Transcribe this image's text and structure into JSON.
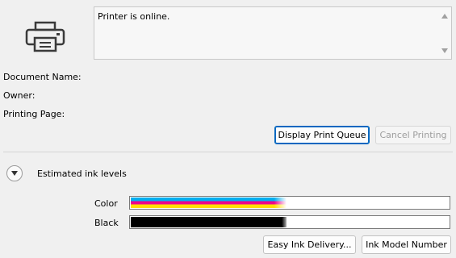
{
  "status": {
    "message": "Printer is online."
  },
  "details": {
    "document_name_label": "Document Name:",
    "owner_label": "Owner:",
    "printing_page_label": "Printing Page:"
  },
  "buttons": {
    "display_queue": "Display Print Queue",
    "cancel_printing": "Cancel Printing",
    "easy_ink_delivery": "Easy Ink Delivery...",
    "ink_model_number": "Ink Model Number"
  },
  "ink_section": {
    "title": "Estimated ink levels",
    "color": {
      "label": "Color",
      "level_fraction": 0.49,
      "colors": [
        "#00aeef",
        "#ec008c",
        "#ffde00"
      ]
    },
    "black": {
      "label": "Black",
      "level_fraction": 0.49,
      "color": "#000000"
    }
  },
  "icons": {
    "printer": "printer-icon",
    "scroll_up": "scroll-up-icon",
    "scroll_down": "scroll-down-icon",
    "expand": "chevron-down-icon"
  },
  "accent_color": "#0067c0"
}
